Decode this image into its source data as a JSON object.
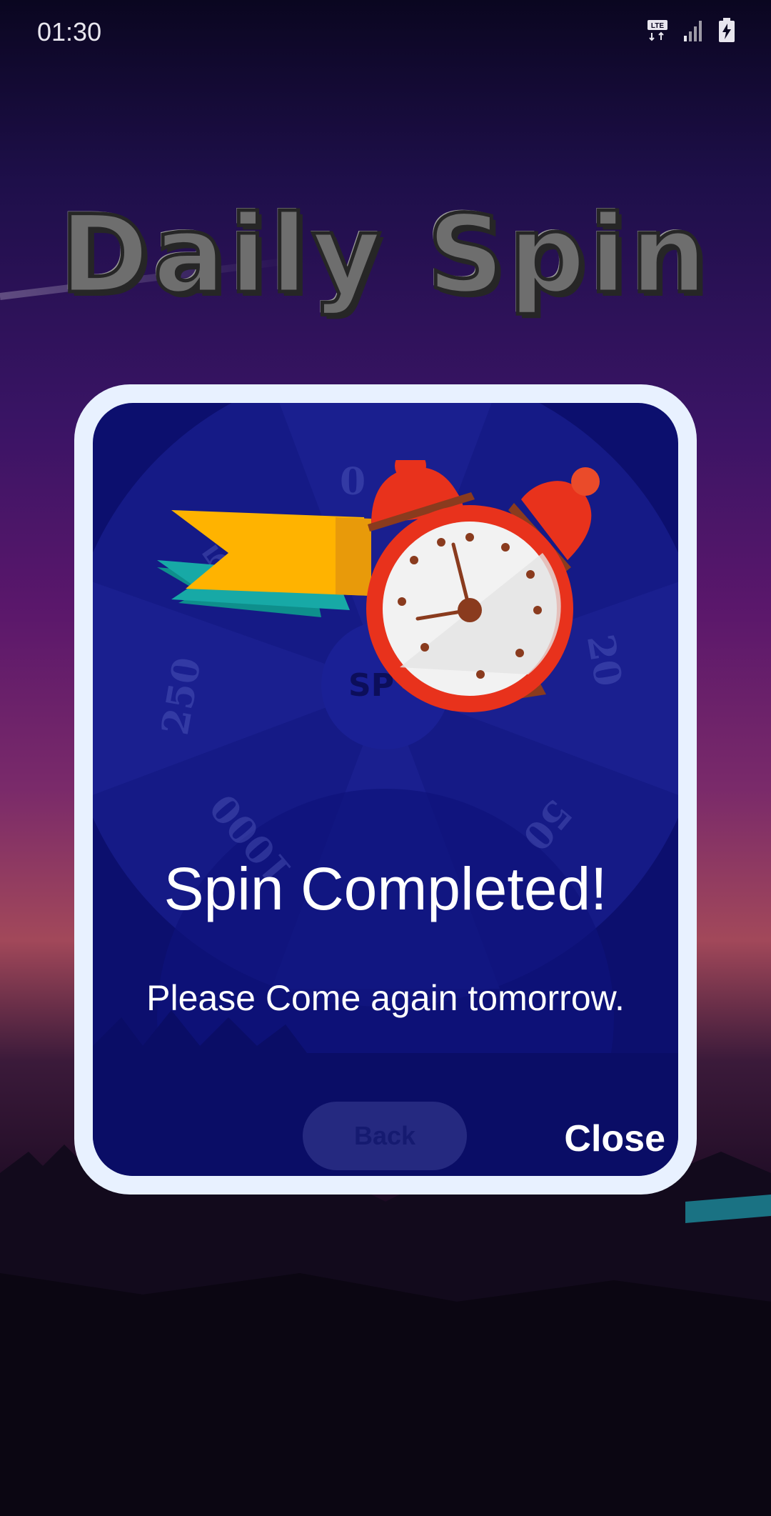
{
  "status_bar": {
    "time": "01:30",
    "network_label": "LTE"
  },
  "screen": {
    "title": "Daily Spin"
  },
  "wheel": {
    "center_label": "SP",
    "segment_values": [
      "0",
      "1",
      "20",
      "50",
      "1000",
      "250",
      "500"
    ]
  },
  "background_button": {
    "label": "Back"
  },
  "dialog": {
    "headline": "Spin Completed!",
    "message": "Please Come again tomorrow.",
    "close_label": "Close"
  },
  "colors": {
    "dialog_border": "#e8f1ff",
    "dialog_fill": "#0c0f6e",
    "clock_red": "#e8321c",
    "ribbon_yellow": "#ffb300",
    "ribbon_teal": "#17a9a6"
  },
  "icons": [
    "lte-icon",
    "signal-icon",
    "battery-charging-icon",
    "alarm-clock-icon",
    "ribbon-icon"
  ]
}
